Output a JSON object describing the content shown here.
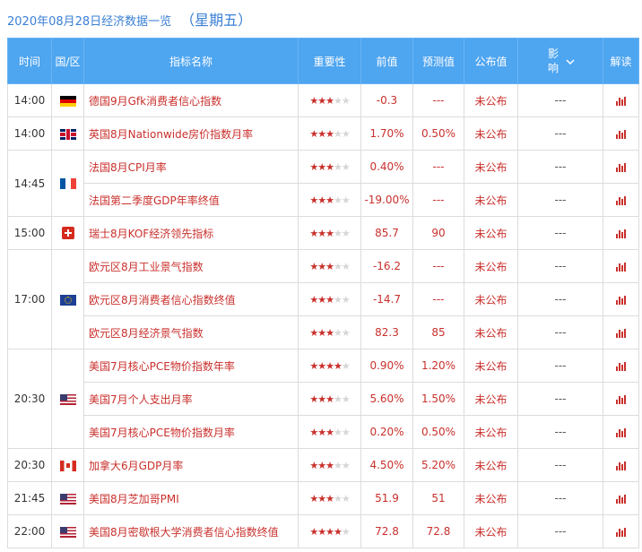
{
  "header": {
    "date_title": "2020年08月28日经济数据一览",
    "weekday": "（星期五）"
  },
  "columns": {
    "time": "时间",
    "region": "国/区",
    "indicator": "指标名称",
    "importance": "重要性",
    "previous": "前值",
    "forecast": "预测值",
    "published": "公布值",
    "impact": "影响",
    "analysis": "解读"
  },
  "colors": {
    "header_bg": "#4ea5f0",
    "title": "#3a7fd5",
    "accent_red": "#c9302c"
  },
  "groups": [
    {
      "time": "14:00",
      "flag": "germany-flag",
      "rows": [
        {
          "name": "德国9月Gfk消费者信心指数",
          "stars": 3,
          "previous": "-0.3",
          "forecast": "---",
          "published": "未公布",
          "impact": "---"
        }
      ]
    },
    {
      "time": "14:00",
      "flag": "uk-flag",
      "rows": [
        {
          "name": "英国8月Nationwide房价指数月率",
          "stars": 3,
          "previous": "1.70%",
          "forecast": "0.50%",
          "published": "未公布",
          "impact": "---"
        }
      ]
    },
    {
      "time": "14:45",
      "flag": "france-flag",
      "rows": [
        {
          "name": "法国8月CPI月率",
          "stars": 3,
          "previous": "0.40%",
          "forecast": "---",
          "published": "未公布",
          "impact": "---"
        },
        {
          "name": "法国第二季度GDP年率终值",
          "stars": 3,
          "previous": "-19.00%",
          "forecast": "---",
          "published": "未公布",
          "impact": "---"
        }
      ]
    },
    {
      "time": "15:00",
      "flag": "switzerland-flag",
      "rows": [
        {
          "name": "瑞士8月KOF经济领先指标",
          "stars": 3,
          "previous": "85.7",
          "forecast": "90",
          "published": "未公布",
          "impact": "---"
        }
      ]
    },
    {
      "time": "17:00",
      "flag": "eu-flag",
      "rows": [
        {
          "name": "欧元区8月工业景气指数",
          "stars": 3,
          "previous": "-16.2",
          "forecast": "---",
          "published": "未公布",
          "impact": "---"
        },
        {
          "name": "欧元区8月消费者信心指数终值",
          "stars": 3,
          "previous": "-14.7",
          "forecast": "---",
          "published": "未公布",
          "impact": "---"
        },
        {
          "name": "欧元区8月经济景气指数",
          "stars": 3,
          "previous": "82.3",
          "forecast": "85",
          "published": "未公布",
          "impact": "---"
        }
      ]
    },
    {
      "time": "20:30",
      "flag": "us-flag",
      "rows": [
        {
          "name": "美国7月核心PCE物价指数年率",
          "stars": 4,
          "previous": "0.90%",
          "forecast": "1.20%",
          "published": "未公布",
          "impact": "---"
        },
        {
          "name": "美国7月个人支出月率",
          "stars": 3,
          "previous": "5.60%",
          "forecast": "1.50%",
          "published": "未公布",
          "impact": "---"
        },
        {
          "name": "美国7月核心PCE物价指数月率",
          "stars": 3,
          "previous": "0.20%",
          "forecast": "0.50%",
          "published": "未公布",
          "impact": "---"
        }
      ]
    },
    {
      "time": "20:30",
      "flag": "canada-flag",
      "rows": [
        {
          "name": "加拿大6月GDP月率",
          "stars": 3,
          "previous": "4.50%",
          "forecast": "5.20%",
          "published": "未公布",
          "impact": "---"
        }
      ]
    },
    {
      "time": "21:45",
      "flag": "us-flag",
      "rows": [
        {
          "name": "美国8月芝加哥PMI",
          "stars": 3,
          "previous": "51.9",
          "forecast": "51",
          "published": "未公布",
          "impact": "---"
        }
      ]
    },
    {
      "time": "22:00",
      "flag": "us-flag",
      "rows": [
        {
          "name": "美国8月密歇根大学消费者信心指数终值",
          "stars": 4,
          "previous": "72.8",
          "forecast": "72.8",
          "published": "未公布",
          "impact": "---"
        }
      ]
    }
  ]
}
